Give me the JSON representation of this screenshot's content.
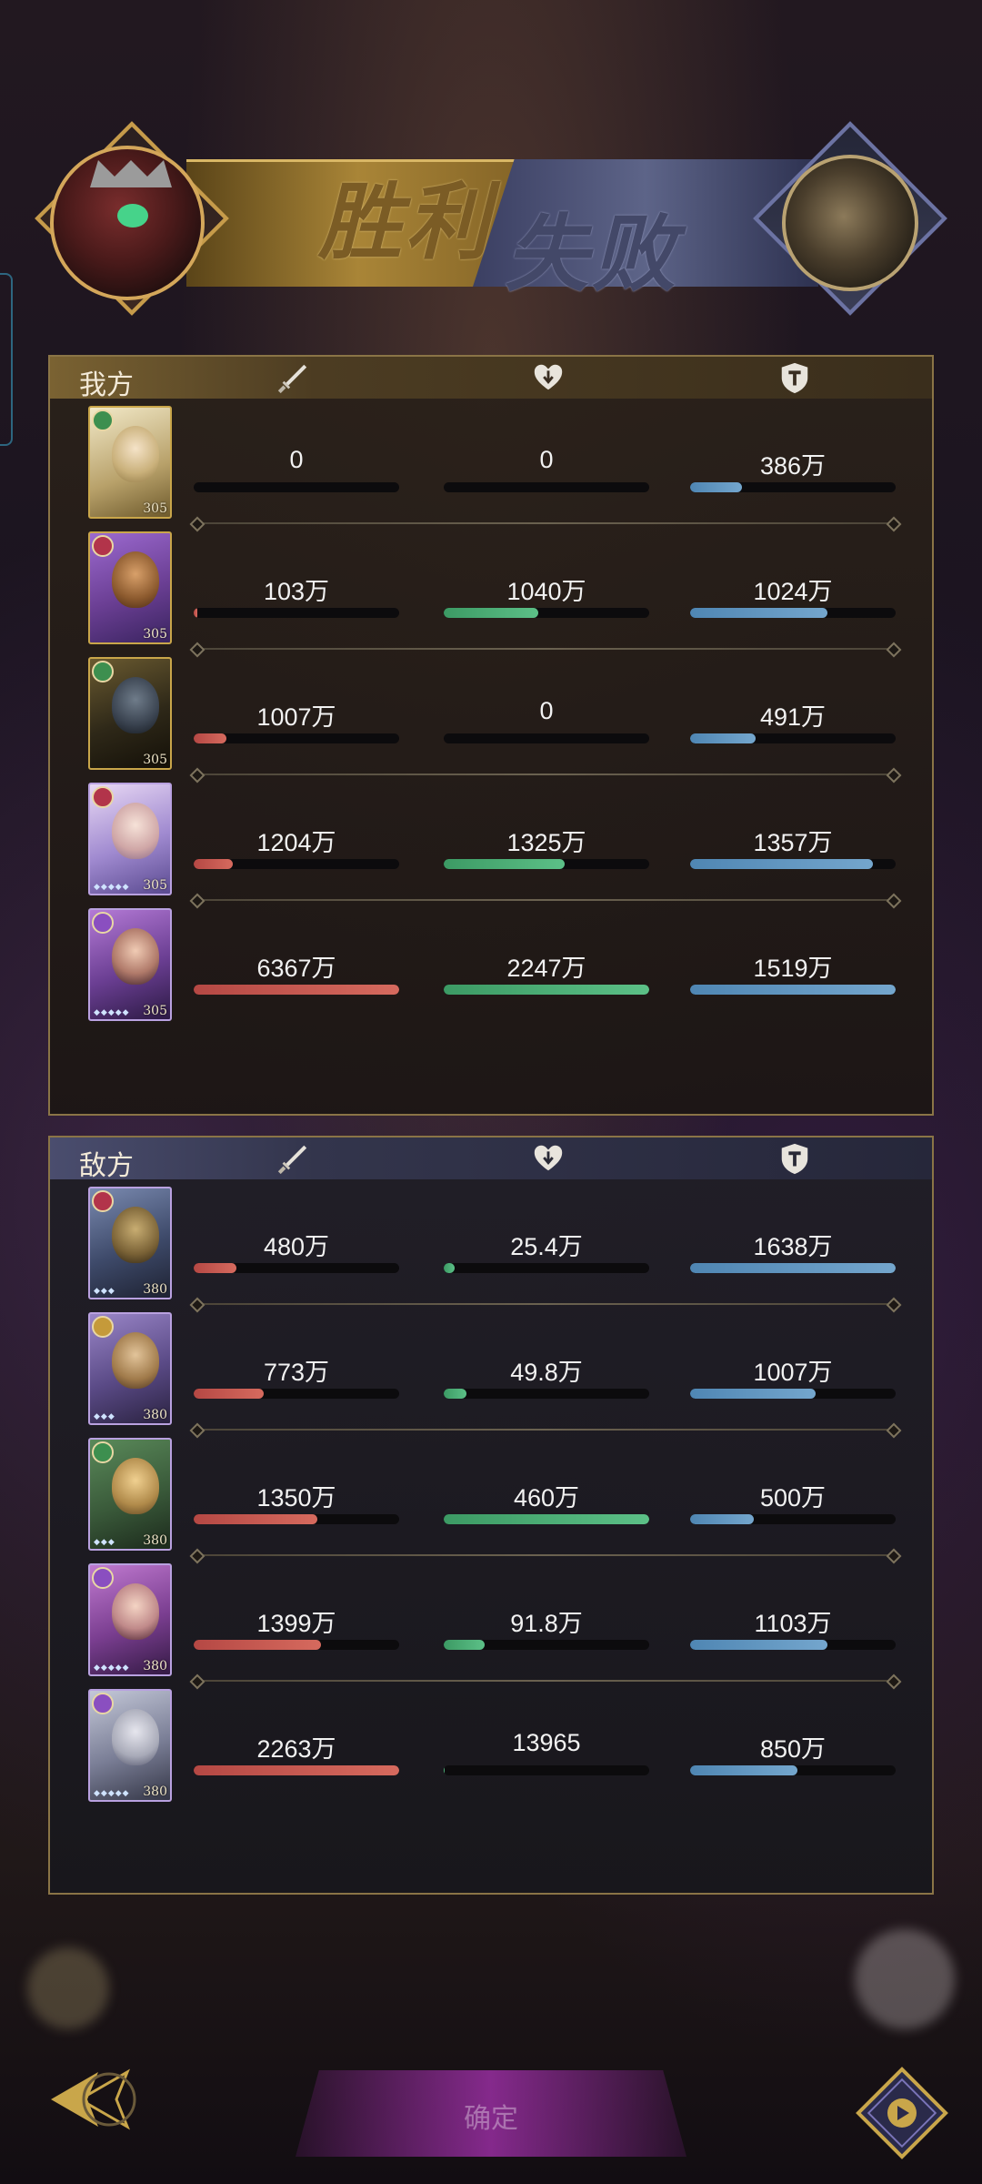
{
  "header": {
    "win_text": "胜利",
    "lose_text": "失败"
  },
  "ours": {
    "title": "我方",
    "rows": [
      {
        "damage": "0",
        "heal": "0",
        "tank": "386万",
        "damage_pct": 0,
        "heal_pct": 0,
        "tank_pct": 25,
        "level": "305"
      },
      {
        "damage": "103万",
        "heal": "1040万",
        "tank": "1024万",
        "damage_pct": 1.6,
        "heal_pct": 46,
        "tank_pct": 67,
        "level": "305"
      },
      {
        "damage": "1007万",
        "heal": "0",
        "tank": "491万",
        "damage_pct": 16,
        "heal_pct": 0,
        "tank_pct": 32,
        "level": "305"
      },
      {
        "damage": "1204万",
        "heal": "1325万",
        "tank": "1357万",
        "damage_pct": 19,
        "heal_pct": 59,
        "tank_pct": 89,
        "level": "305"
      },
      {
        "damage": "6367万",
        "heal": "2247万",
        "tank": "1519万",
        "damage_pct": 100,
        "heal_pct": 100,
        "tank_pct": 100,
        "level": "305"
      }
    ]
  },
  "theirs": {
    "title": "敌方",
    "rows": [
      {
        "damage": "480万",
        "heal": "25.4万",
        "tank": "1638万",
        "damage_pct": 21,
        "heal_pct": 5.5,
        "tank_pct": 100,
        "level": "380"
      },
      {
        "damage": "773万",
        "heal": "49.8万",
        "tank": "1007万",
        "damage_pct": 34,
        "heal_pct": 11,
        "tank_pct": 61,
        "level": "380"
      },
      {
        "damage": "1350万",
        "heal": "460万",
        "tank": "500万",
        "damage_pct": 60,
        "heal_pct": 100,
        "tank_pct": 31,
        "level": "380"
      },
      {
        "damage": "1399万",
        "heal": "91.8万",
        "tank": "1103万",
        "damage_pct": 62,
        "heal_pct": 20,
        "tank_pct": 67,
        "level": "380"
      },
      {
        "damage": "2263万",
        "heal": "13965",
        "tank": "850万",
        "damage_pct": 100,
        "heal_pct": 0.3,
        "tank_pct": 52,
        "level": "380"
      }
    ]
  },
  "footer": {
    "middle_label": "确定"
  },
  "colors": {
    "damage": "#c9524c",
    "heal": "#4fb176",
    "tank": "#5f95c2",
    "gold": "#c9a64a"
  },
  "icons": {
    "damage": "sword-icon",
    "heal": "heart-icon",
    "tank": "shield-icon",
    "back": "back-arrow-icon",
    "replay": "replay-icon"
  }
}
